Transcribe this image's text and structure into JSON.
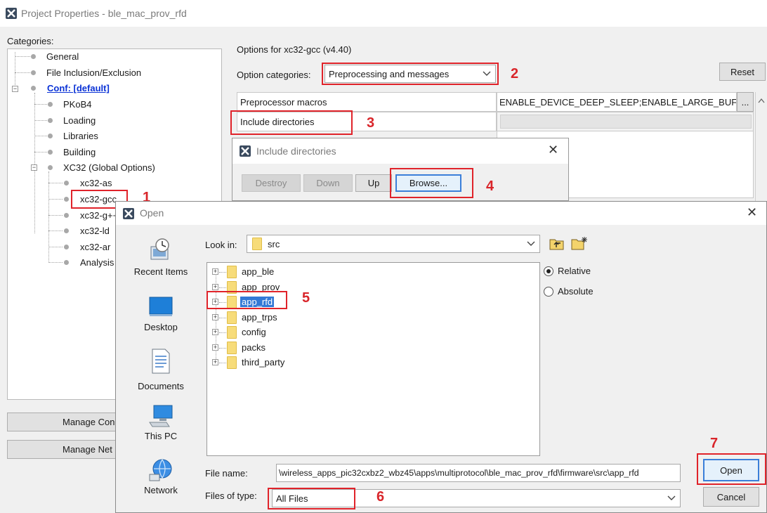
{
  "window": {
    "title": "Project Properties - ble_mac_prov_rfd",
    "categories_label": "Categories:",
    "tree": [
      {
        "label": "General"
      },
      {
        "label": "File Inclusion/Exclusion"
      },
      {
        "label": "Conf: [default]"
      },
      {
        "label": "PKoB4"
      },
      {
        "label": "Loading"
      },
      {
        "label": "Libraries"
      },
      {
        "label": "Building"
      },
      {
        "label": "XC32 (Global Options)"
      },
      {
        "label": "xc32-as"
      },
      {
        "label": "xc32-gcc"
      },
      {
        "label": "xc32-g++"
      },
      {
        "label": "xc32-ld"
      },
      {
        "label": "xc32-ar"
      },
      {
        "label": "Analysis"
      }
    ],
    "manage_config_label": "Manage Con",
    "manage_networks_label": "Manage Net"
  },
  "options": {
    "header": "Options for xc32-gcc (v4.40)",
    "category_label": "Option categories:",
    "category_value": "Preprocessing and messages",
    "reset_label": "Reset",
    "rows": [
      {
        "name": "Preprocessor macros",
        "value": "ENABLE_DEVICE_DEEP_SLEEP;ENABLE_LARGE_BUFFER",
        "more": "..."
      },
      {
        "name": "Include directories",
        "value": ""
      }
    ]
  },
  "include_dialog": {
    "title": "Include directories",
    "buttons": {
      "destroy": "Destroy",
      "down": "Down",
      "up": "Up",
      "browse": "Browse..."
    }
  },
  "open_dialog": {
    "title": "Open",
    "look_in_label": "Look in:",
    "look_in_value": "src",
    "shortcuts": [
      {
        "label": "Recent Items",
        "icon": "recent-items-icon"
      },
      {
        "label": "Desktop",
        "icon": "desktop-icon"
      },
      {
        "label": "Documents",
        "icon": "documents-icon"
      },
      {
        "label": "This PC",
        "icon": "this-pc-icon"
      },
      {
        "label": "Network",
        "icon": "network-icon"
      }
    ],
    "folders": [
      {
        "name": "app_ble"
      },
      {
        "name": "app_prov"
      },
      {
        "name": "app_rfd"
      },
      {
        "name": "app_trps"
      },
      {
        "name": "config"
      },
      {
        "name": "packs"
      },
      {
        "name": "third_party"
      }
    ],
    "selected_folder": "app_rfd",
    "path_mode": {
      "relative": "Relative",
      "absolute": "Absolute",
      "selected": "relative"
    },
    "file_name_label": "File name:",
    "file_name_value": "\\wireless_apps_pic32cxbz2_wbz45\\apps\\multiprotocol\\ble_mac_prov_rfd\\firmware\\src\\app_rfd",
    "files_of_type_label": "Files of type:",
    "files_of_type_value": "All Files",
    "open_label": "Open",
    "cancel_label": "Cancel"
  },
  "annotations": [
    "1",
    "2",
    "3",
    "4",
    "5",
    "6",
    "7"
  ],
  "colors": {
    "annotation": "#e0232a",
    "link": "#0a32d6",
    "selection": "#3379d6"
  }
}
